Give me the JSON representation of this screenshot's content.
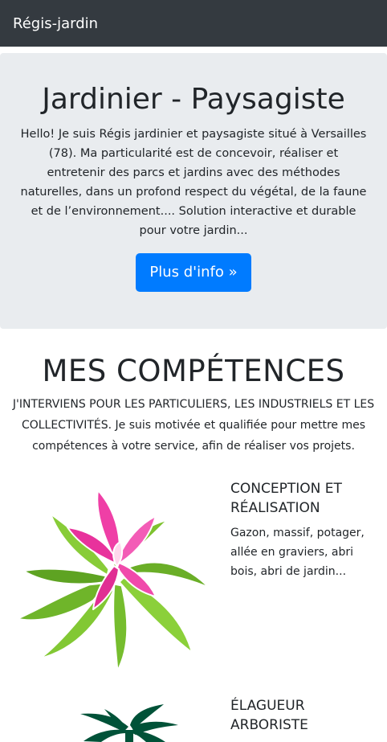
{
  "navbar": {
    "brand": "Régis-jardin"
  },
  "hero": {
    "title": "Jardinier - Paysagiste",
    "text": "Hello! Je suis Régis jardinier et paysagiste situé à Versailles (78). Ma particularité est de concevoir, réaliser et entretenir des parcs et jardins avec des méthodes naturelles, dans un profond respect du végétal, de la faune et de l’environnement.... Solution interactive et durable pour votre jardin...",
    "button": "Plus d'info »",
    "button_color": "#007bff"
  },
  "skills": {
    "title": "MES COMPÉTENCES",
    "intro": "J'INTERVIENS POUR LES PARTICULIERS, LES INDUSTRIELS ET LES COLLECTIVITÉS. Je suis motivée et qualifiée pour mettre mes compétences à votre service, afin de réaliser vos projets.",
    "items": [
      {
        "title": "CONCEPTION ET RÉALISATION",
        "description": "Gazon, massif, potager, allée en graviers, abri bois, abri de jardin...",
        "image": "bromeliad-plant-illustration"
      },
      {
        "title": "ÉLAGUEUR ARBORISTE",
        "description": "",
        "image": "palm-tree-illustration"
      }
    ]
  },
  "colors": {
    "navbar": "#343a40",
    "jumbotron": "#e9ecef",
    "text": "#212529",
    "leaf": "#7ec22f",
    "flower": "#ef3fa6",
    "palm": "#005238"
  }
}
